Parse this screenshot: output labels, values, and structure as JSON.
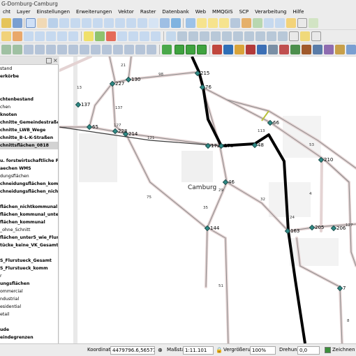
{
  "window": {
    "title": "G-Dornburg-Camburg"
  },
  "menu": [
    "cht",
    "Layer",
    "Einstellungen",
    "Erweiterungen",
    "Vektor",
    "Raster",
    "Datenbank",
    "Web",
    "MMQGIS",
    "SCP",
    "Verarbeitung",
    "Hilfe"
  ],
  "layers": [
    {
      "label": "stand",
      "bold": false
    },
    {
      "label": "erkörbe",
      "bold": true
    },
    {
      "label": "",
      "bold": false
    },
    {
      "label": "",
      "bold": false
    },
    {
      "label": "chtenbestand",
      "bold": true
    },
    {
      "label": "chen",
      "bold": false
    },
    {
      "label": "knoten",
      "bold": true
    },
    {
      "label": "chnitte_Gemeindestraßen",
      "bold": true
    },
    {
      "label": "chnitte_LWB_Wege",
      "bold": true
    },
    {
      "label": "chnitte_B-L-K-Straßen",
      "bold": true
    },
    {
      "label": "chnittsflächen_0818",
      "bold": true,
      "selected": true
    },
    {
      "label": "",
      "bold": false
    },
    {
      "label": "u. forstwirtschaftliche Flä...",
      "bold": true
    },
    {
      "label": "aechen WMS",
      "bold": true
    },
    {
      "label": "dungsflächen",
      "bold": false
    },
    {
      "label": "chneidungsflächen_komm...",
      "bold": true
    },
    {
      "label": "chneidungsflächen_nicht-...",
      "bold": true
    },
    {
      "label": "",
      "bold": false
    },
    {
      "label": "flächen_nichtkommunal",
      "bold": true
    },
    {
      "label": "flächen_kommunal_unter...",
      "bold": true
    },
    {
      "label": "flächen_kommunal",
      "bold": true
    },
    {
      "label": "_ohne_Schnitt",
      "bold": false
    },
    {
      "label": "flächen_unter5_wie_Flurs...",
      "bold": true
    },
    {
      "label": "tücke_keine_VK_Gesamt",
      "bold": true
    },
    {
      "label": "",
      "bold": false
    },
    {
      "label": "S_Flurstueck_Gesamt",
      "bold": true
    },
    {
      "label": "S_Flurstueck_komm",
      "bold": true
    },
    {
      "label": "r",
      "bold": false
    },
    {
      "label": "ungsflächen",
      "bold": true
    },
    {
      "label": "ommercial",
      "bold": false
    },
    {
      "label": "ndustrial",
      "bold": false
    },
    {
      "label": "esidential",
      "bold": false
    },
    {
      "label": "etail",
      "bold": false
    },
    {
      "label": "",
      "bold": false
    },
    {
      "label": "ude",
      "bold": true
    },
    {
      "label": "eindegrenzen",
      "bold": true
    }
  ],
  "map": {
    "place_label": "Camburg",
    "node_labels": [
      "215",
      "76",
      "227",
      "130",
      "137",
      "65",
      "228",
      "214",
      "172",
      "178",
      "66",
      "48",
      "210",
      "46",
      "144",
      "205",
      "206",
      "163",
      "7"
    ],
    "edge_labels": [
      "21",
      "98",
      "13",
      "127",
      "137",
      "121",
      "75",
      "113",
      "53",
      "29",
      "32",
      "35",
      "4",
      "24",
      "51",
      "127",
      "8"
    ]
  },
  "statusbar": {
    "coord_label": "Koordinate",
    "coord_value": "4479796.6,5657760.2",
    "scale_label": "Maßstab",
    "scale_value": "1:11.101",
    "magnifier_label": "Vergrößerung",
    "magnifier_value": "100%",
    "rotation_label": "Drehung",
    "rotation_value": "0,0",
    "render_label": "Zeichnen"
  }
}
